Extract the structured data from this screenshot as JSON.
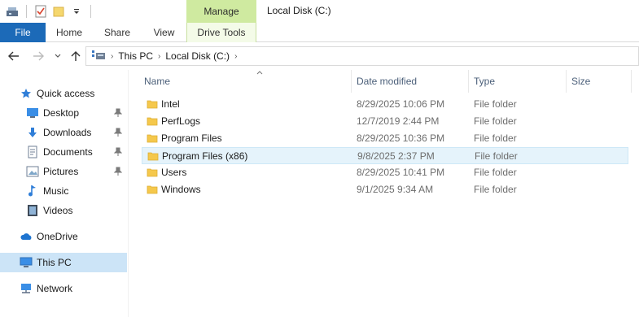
{
  "titlebar": {
    "window_title": "Local Disk (C:)",
    "context_tab_label": "Manage"
  },
  "ribbon": {
    "tabs": [
      {
        "label": "File"
      },
      {
        "label": "Home"
      },
      {
        "label": "Share"
      },
      {
        "label": "View"
      },
      {
        "label": "Drive Tools"
      }
    ]
  },
  "address": {
    "crumbs": [
      "This PC",
      "Local Disk (C:)"
    ]
  },
  "sidebar": {
    "items": [
      {
        "label": "Quick access",
        "icon": "star-icon"
      },
      {
        "label": "Desktop",
        "icon": "desktop-icon",
        "pinned": true
      },
      {
        "label": "Downloads",
        "icon": "download-icon",
        "pinned": true
      },
      {
        "label": "Documents",
        "icon": "documents-icon",
        "pinned": true
      },
      {
        "label": "Pictures",
        "icon": "pictures-icon",
        "pinned": true
      },
      {
        "label": "Music",
        "icon": "music-icon"
      },
      {
        "label": "Videos",
        "icon": "videos-icon"
      },
      {
        "label": "OneDrive",
        "icon": "cloud-icon"
      },
      {
        "label": "This PC",
        "icon": "computer-icon",
        "selected": true
      },
      {
        "label": "Network",
        "icon": "network-icon"
      }
    ]
  },
  "columns": {
    "name": "Name",
    "date": "Date modified",
    "type": "Type",
    "size": "Size"
  },
  "files": [
    {
      "name": "Intel",
      "date": "8/29/2025 10:06 PM",
      "type": "File folder"
    },
    {
      "name": "PerfLogs",
      "date": "12/7/2019 2:44 PM",
      "type": "File folder"
    },
    {
      "name": "Program Files",
      "date": "8/29/2025 10:36 PM",
      "type": "File folder"
    },
    {
      "name": "Program Files (x86)",
      "date": "9/8/2025 2:37 PM",
      "type": "File folder",
      "hover": true
    },
    {
      "name": "Users",
      "date": "8/29/2025 10:41 PM",
      "type": "File folder"
    },
    {
      "name": "Windows",
      "date": "9/1/2025 9:34 AM",
      "type": "File folder"
    }
  ],
  "colors": {
    "file_tab": "#1c6ab8",
    "manage_tab": "#cfeaa0",
    "selection": "#cce4f7",
    "hover_row": "#e5f3fb",
    "folder": "#f5c84c"
  }
}
